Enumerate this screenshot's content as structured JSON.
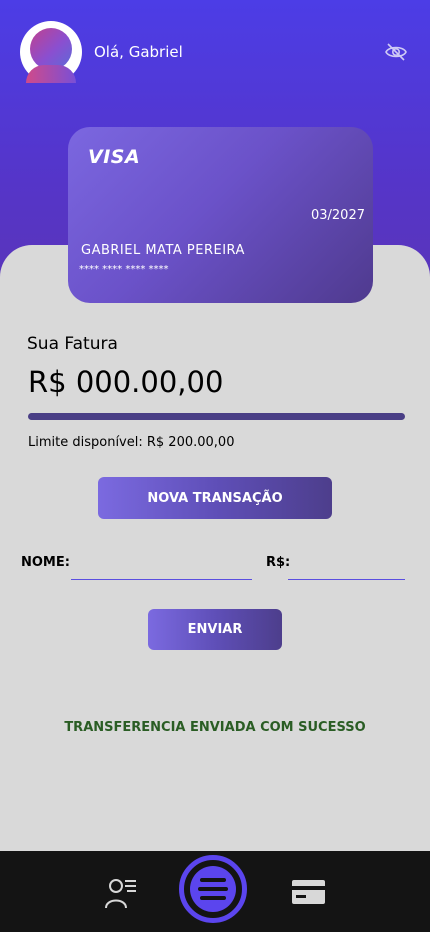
{
  "header": {
    "greeting": "Olá, Gabriel",
    "avatar_icon": "user-avatar",
    "visibility_icon": "eye-off-icon"
  },
  "card": {
    "brand": "VISA",
    "expiry": "03/2027",
    "holder": "GABRIEL MATA PEREIRA",
    "number_masked": "**** **** **** ****"
  },
  "invoice": {
    "label": "Sua Fatura",
    "value": "R$ 000.00,00",
    "limit_text": "Limite disponível: R$ 200.00,00"
  },
  "actions": {
    "new_transaction_label": "NOVA TRANSAÇÃO",
    "send_label": "ENVIAR"
  },
  "form": {
    "name_label": "NOME:",
    "name_value": "",
    "amount_label": "R$:",
    "amount_value": ""
  },
  "status": {
    "message": "TRANSFERENCIA ENVIADA COM SUCESSO",
    "color": "#2a5d24"
  },
  "nav": {
    "items": [
      {
        "icon": "profile-list-icon"
      },
      {
        "icon": "menu-icon"
      },
      {
        "icon": "credit-card-icon"
      }
    ]
  },
  "colors": {
    "accent": "#5b45ee",
    "header_bg": "#4c3de6",
    "panel_bg": "#d9d9d9",
    "nav_bg": "#141414"
  }
}
